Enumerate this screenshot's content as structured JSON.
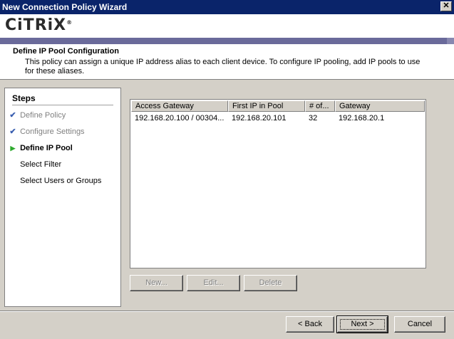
{
  "window": {
    "title": "New Connection Policy Wizard",
    "close_glyph": "✕"
  },
  "header": {
    "logo_text": "CiTRiX",
    "logo_reg": "®",
    "page_title": "Define IP Pool Configuration",
    "description": "This policy can assign a unique IP address alias to each client device. To configure IP pooling, add IP pools to use for these aliases."
  },
  "steps": {
    "title": "Steps",
    "items": [
      {
        "label": "Define Policy",
        "state": "done",
        "mark": "✔"
      },
      {
        "label": "Configure Settings",
        "state": "done",
        "mark": "✔"
      },
      {
        "label": "Define IP Pool",
        "state": "current",
        "mark": "▶"
      },
      {
        "label": "Select Filter",
        "state": "pending",
        "mark": ""
      },
      {
        "label": "Select Users or Groups",
        "state": "pending",
        "mark": ""
      }
    ]
  },
  "pool_table": {
    "columns": [
      "Access Gateway",
      "First IP in Pool",
      "# of...",
      "Gateway"
    ],
    "rows": [
      [
        "192.168.20.100 / 00304...",
        "192.168.20.101",
        "32",
        "192.168.20.1"
      ]
    ]
  },
  "pool_buttons": {
    "new_label": "New...",
    "edit_label": "Edit...",
    "delete_label": "Delete"
  },
  "footer": {
    "back_label": "< Back",
    "next_label": "Next >",
    "cancel_label": "Cancel"
  },
  "colors": {
    "titlebar": "#0a246a",
    "logo_bar": "#6a6a9a",
    "check": "#3a5fb0",
    "current_arrow": "#2eaa2e"
  }
}
